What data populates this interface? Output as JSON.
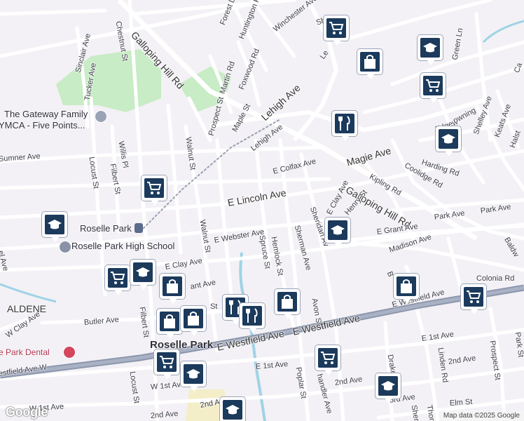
{
  "map": {
    "streets": {
      "forest_dr": "Forest Dr",
      "huntington_rd": "Huntington Rd",
      "winchester_ave": "Winchester Ave",
      "sh": "Sh",
      "lehigh_ave": "Lehigh Ave",
      "le": "Le",
      "green_ln": "Green Ln",
      "ca": "Ca",
      "sinclair_ave": "Sinclair Ave",
      "chestnut_st": "Chestnut St",
      "galloping_hill_rd": "Galloping Hill Rd",
      "tucker_ave": "Tucker Ave",
      "martin_rd": "Martin Rd",
      "foxwood_rd": "Foxwood Rd",
      "prospect_st": "Prospect St",
      "maple_st": "Maple St",
      "edgewood": "Edgew",
      "downing": "owning",
      "shelley_ave": "Shelley Ave",
      "keats_ave": "Keats Ave",
      "halst": "Halst",
      "walnut_st": "Walnut St",
      "sumner_ave": "Sumner Ave",
      "willis_pl": "Willis Pl",
      "filbert_st": "Filbert St",
      "locust_st": "Locust St",
      "e_colfax_ave": "E Colfax Ave",
      "magie_ave": "Magie Ave",
      "harding_rd": "Harding Rd",
      "coolidge_rd": "Coolidge Rd",
      "kipling_rd": "Kipling Rd",
      "galloping_hill_rd_e": "Galloping Hill Rd",
      "e_lincoln_ave": "E Lincoln Ave",
      "hemlock_st": "Hemlock St",
      "sheridan_ave": "Sheridan Av",
      "e_clay_ave": "E Clay Ave",
      "henry_st": "Henry St",
      "park_ave": "Park Ave",
      "park_ave_2": "Park Ave",
      "baldw": "Baldw",
      "e_webster_ave": "E Webster Ave",
      "walnut_st_s": "Walnut St",
      "spruce_st": "Spruce St",
      "sherman_ave": "Sherman Ave",
      "e_grant_ave": "E Grant Ave",
      "madison_ave": "Madison Ave",
      "el_ave": "el Ave",
      "clay_ave": "E Clay Ave",
      "colonia_rd": "Colonia Rd",
      "grant_ave": "ant Ave",
      "b": "B",
      "e_westfield_ave_ne": "E Westfield Ave",
      "st": "St",
      "avon_st": "Avon St",
      "w_clay_ave": "W Clay Ave",
      "butler_ave": "Butler Ave",
      "filbert_st_s": "Filbert St",
      "e_westfield_ave": "E Westfield Ave",
      "e_westfield_ave_2": "E Westfield Ave",
      "e_1st_ave": "E 1st Ave",
      "e_1st_ave_2": "E 1st Ave",
      "w_1st_ave": "W 1st Ave",
      "locust_st_s": "Locust St",
      "poplar_st": "Poplar St",
      "chandler_ave": "handler Ave",
      "drake": "Drake",
      "linden_rd": "Linden Rd",
      "2nd_ave_e": "2nd Ave",
      "2nd_ave_c": "2nd Ave",
      "prospect_st_e": "Prospect St",
      "park_st": "Park St",
      "3rd_ave": "3rd Ave",
      "elm_st": "Elm St",
      "2nd_ave_w": "2nd Ave",
      "2nd_av": "2nd Av",
      "westfield_ave_w": "estfield Ave W",
      "w_1st_ave_w": "W 1st Ave",
      "el_ave_w": "el Ave",
      "sheri": "Sheri",
      "thorn": "Thorn"
    },
    "places": {
      "ymca_line1": "The Gateway Family",
      "ymca_line2": "YMCA - Five Points...",
      "roselle_park_station": "Roselle Park",
      "roselle_park_hs": "Roselle Park High School",
      "aldene": "ALDENE",
      "roselle_park_town": "Roselle Park",
      "dental": "e Park Dental"
    },
    "markers": [
      {
        "type": "grocery-icon"
      },
      {
        "type": "school-icon"
      },
      {
        "type": "shopping-bag-icon"
      },
      {
        "type": "grocery-icon"
      },
      {
        "type": "restaurant-icon"
      },
      {
        "type": "school-icon"
      },
      {
        "type": "grocery-icon"
      },
      {
        "type": "school-icon"
      },
      {
        "type": "school-icon"
      },
      {
        "type": "shopping-bag-icon"
      },
      {
        "type": "grocery-icon"
      },
      {
        "type": "grocery-icon"
      },
      {
        "type": "school-icon"
      },
      {
        "type": "shopping-bag-icon"
      },
      {
        "type": "restaurant-icon"
      },
      {
        "type": "shopping-bag-icon"
      },
      {
        "type": "restaurant-icon"
      },
      {
        "type": "shopping-bag-icon"
      },
      {
        "type": "shopping-bag-icon"
      },
      {
        "type": "grocery-icon"
      },
      {
        "type": "school-icon"
      },
      {
        "type": "grocery-icon"
      },
      {
        "type": "school-icon"
      },
      {
        "type": "school-icon"
      }
    ],
    "attribution": "Map data ©2025 Google",
    "logo": "Google",
    "colors": {
      "background": "#f3f1f5",
      "street": "#ffffff",
      "rail": "#8a93a6",
      "major_road": "#6e7b99",
      "park": "#c8ecc5",
      "water": "#9fd3e6",
      "marker": "#1b3a5c"
    }
  }
}
